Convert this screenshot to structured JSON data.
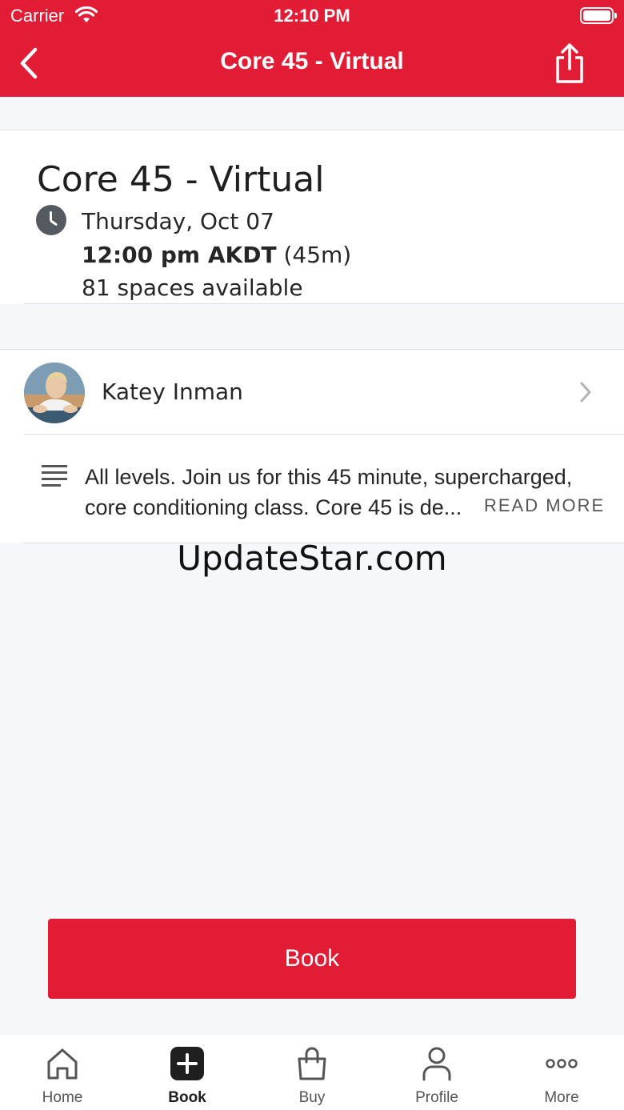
{
  "status_bar": {
    "carrier": "Carrier",
    "time": "12:10 PM"
  },
  "nav": {
    "title": "Core 45 - Virtual",
    "back_icon": "chevron-left-icon",
    "share_icon": "share-icon"
  },
  "class_info": {
    "title": "Core 45 - Virtual",
    "date": "Thursday, Oct 07",
    "time": "12:00 pm AKDT",
    "duration": "(45m)",
    "spaces": "81 spaces available"
  },
  "instructor": {
    "name": "Katey Inman"
  },
  "description": {
    "line1": "All levels. Join us for this 45 minute, supercharged,",
    "line2": "core conditioning class. Core 45 is de...",
    "read_more": "READ MORE"
  },
  "watermark": "UpdateStar.com",
  "book_button": {
    "label": "Book"
  },
  "tabs": [
    {
      "label": "Home",
      "icon": "home-icon"
    },
    {
      "label": "Book",
      "icon": "plus-square-icon"
    },
    {
      "label": "Buy",
      "icon": "shopping-bag-icon"
    },
    {
      "label": "Profile",
      "icon": "person-icon"
    },
    {
      "label": "More",
      "icon": "more-dots-icon"
    }
  ],
  "colors": {
    "brand": "#e21c35",
    "background": "#f6f7f9"
  }
}
